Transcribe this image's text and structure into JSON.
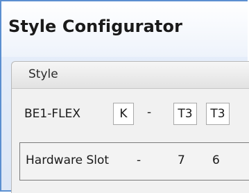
{
  "window": {
    "title": "Style Configurator"
  },
  "style_group": {
    "header": "Style",
    "product_label": "BE1-FLEX",
    "codes": [
      "K",
      "-",
      "T3",
      "T3"
    ]
  },
  "hardware_slot": {
    "label": "Hardware Slot",
    "values": [
      "-",
      "7",
      "6"
    ]
  },
  "colors": {
    "frame_border": "#5b8fd0",
    "panel_bg": "#f1f1f1",
    "text": "#1a1a1a"
  }
}
